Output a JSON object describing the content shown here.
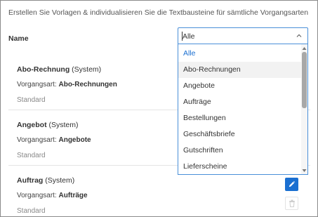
{
  "intro_text": "Erstellen Sie Vorlagen & individualisieren Sie die Textbausteine für sämtliche Vorgangsarten",
  "filter": {
    "label": "Name",
    "selected_value": "Alle",
    "options": [
      "Alle",
      "Abo-Rechnungen",
      "Angebote",
      "Aufträge",
      "Bestellungen",
      "Geschäftsbriefe",
      "Gutschriften",
      "Lieferscheine"
    ]
  },
  "templates": [
    {
      "name": "Abo-Rechnung",
      "suffix": " (System)",
      "type_label": "Vorgangsart: ",
      "type_value": "Abo-Rechnungen",
      "status": "Standard"
    },
    {
      "name": "Angebot",
      "suffix": " (System)",
      "type_label": "Vorgangsart: ",
      "type_value": "Angebote",
      "status": "Standard"
    },
    {
      "name": "Auftrag",
      "suffix": " (System)",
      "type_label": "Vorgangsart: ",
      "type_value": "Aufträge",
      "status": "Standard"
    }
  ],
  "colors": {
    "accent": "#1a6fd1",
    "border_focus": "#4a8fd8"
  },
  "icons": {
    "edit": "pencil-icon",
    "delete": "trash-icon",
    "dropdown": "chevron-up-icon"
  }
}
